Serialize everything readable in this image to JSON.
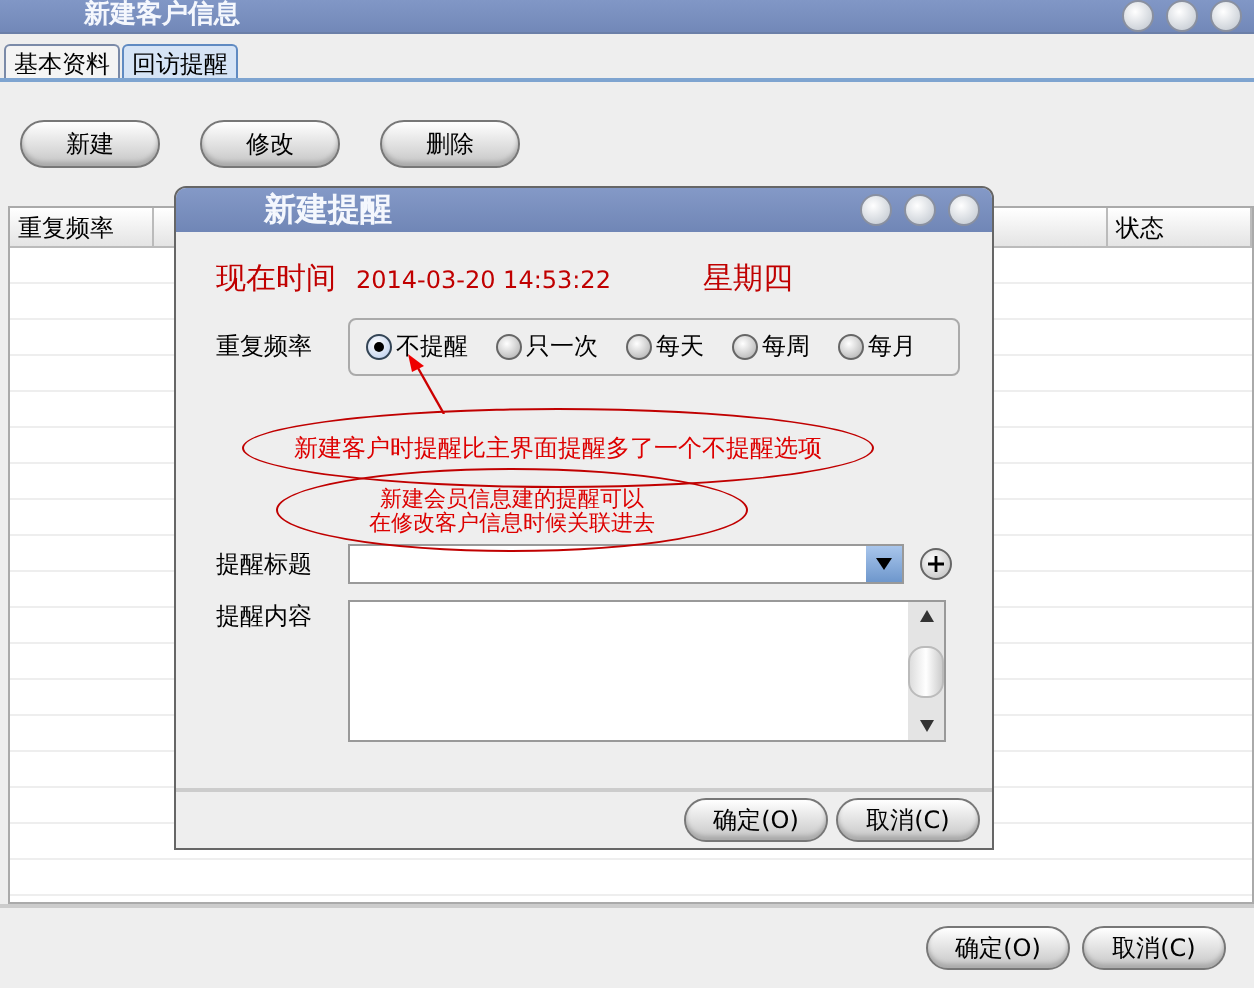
{
  "window": {
    "title": "新建客户信息"
  },
  "tabs": [
    {
      "label": "基本资料",
      "selected": false
    },
    {
      "label": "回访提醒",
      "selected": true
    }
  ],
  "toolbar": [
    "新建",
    "修改",
    "删除"
  ],
  "table": {
    "columns": [
      {
        "label": "重复频率"
      },
      {
        "label": "状态"
      }
    ]
  },
  "buttons": [
    "确定(O)",
    "取消(C)"
  ],
  "dialog": {
    "title": "新建提醒",
    "time_label": "现在时间",
    "time": "2014-03-20 14:53:22",
    "weekday": "星期四",
    "frequency_label": "重复频率",
    "frequency_options": [
      {
        "label": "不提醒",
        "selected": true
      },
      {
        "label": "只一次",
        "selected": false
      },
      {
        "label": "每天",
        "selected": false
      },
      {
        "label": "每周",
        "selected": false
      },
      {
        "label": "每月",
        "selected": false
      }
    ],
    "title_label": "提醒标题",
    "content_label": "提醒内容",
    "buttons": [
      "确定(O)",
      "取消(C)"
    ]
  },
  "annotations": [
    {
      "lines": [
        "新建客户时提醒比主界面提醒多了一个不提醒选项"
      ],
      "arrow": true
    },
    {
      "lines": [
        "新建会员信息建的提醒可以",
        "在修改客户信息时候关联进去"
      ],
      "arrow": false
    }
  ]
}
